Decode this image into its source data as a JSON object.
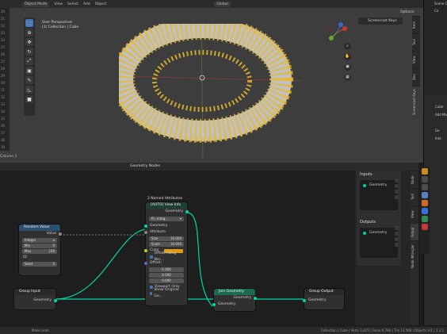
{
  "viewport": {
    "mode": "Object Mode",
    "menu": [
      "View",
      "Select",
      "Add",
      "Object"
    ],
    "orientation": "Global",
    "perspective_label": "User Perspective",
    "collection_label": "(1) Collection | Cube",
    "screencast_tab": "Screencast Keys",
    "options_label": "Options",
    "side_tabs": [
      "Item",
      "Tool",
      "View",
      "Dev",
      "Screencast Keys"
    ],
    "column_label": "Column 1"
  },
  "line_numbers": [
    "20",
    "21",
    "22",
    "23",
    "24",
    "25",
    "26",
    "27",
    "28",
    "29",
    "30",
    "31",
    "32",
    "33",
    "34",
    "35",
    "36",
    "37",
    "38",
    "39"
  ],
  "outliner": {
    "items": [
      "Scene Co",
      "Co",
      "",
      ""
    ]
  },
  "properties": {
    "items": [
      "Cube",
      "Add Mod",
      "",
      "Ge",
      "Inte"
    ]
  },
  "node_editor": {
    "title": "Geometry Nodes",
    "nodes": {
      "named_attributes": {
        "label": "2 Named Attributes"
      },
      "viewer": {
        "title": "[AUTO] View Info",
        "geometry_out": "Geometry",
        "dropdown": "Rr, Integ...",
        "geometry_in": "Geometry",
        "attribute": "Attribute",
        "size_label": "Size",
        "size_value": "10.000",
        "scale_label": "Scale",
        "scale_value": "10.000",
        "color_label": "Color",
        "offset_along": "Offset Along Nor...",
        "offset_label": "Offset:",
        "offset_values": [
          "0.000",
          "0.000",
          "0.000"
        ],
        "viewport_only": "Viewport Only",
        "show_original": "Show Original Ge..."
      },
      "random_value": {
        "title": "Random Value",
        "value_out": "Value",
        "type": "Integer",
        "min_label": "Min",
        "min_value": "0",
        "max_label": "Max",
        "max_value": "100",
        "id_label": "ID",
        "seed_label": "Seed",
        "seed_value": "0"
      },
      "group_input": {
        "title": "Group Input",
        "geometry": "Geometry"
      },
      "join_geometry": {
        "title": "Join Geometry",
        "geometry_out": "Geometry",
        "geometry_in": "Geometry"
      },
      "group_output": {
        "title": "Group Output",
        "geometry": "Geometry"
      }
    }
  },
  "side_panel": {
    "inputs_title": "Inputs",
    "inputs_item": "Geometry",
    "outputs_title": "Outputs",
    "outputs_item": "Geometry",
    "tabs": [
      "Node",
      "Tool",
      "View",
      "Group",
      "Node Wrangler"
    ]
  },
  "status_bar": {
    "left": "Make Links",
    "right": "Collection | Cube | Verts 3,425 | Faces 6,784 | Tris 13,568 | Objects 1/1 | 3.3.1"
  },
  "colors": {
    "accent": "#4772b3",
    "geometry_socket": "#00d6a3",
    "viewer_header": "#1f3f33",
    "join_header": "#1c6a53",
    "group_header": "#2a2a2a",
    "random_header": "#2b4f6e",
    "color_swatch": "#e39a12",
    "torus_text": "#e6b92b"
  }
}
